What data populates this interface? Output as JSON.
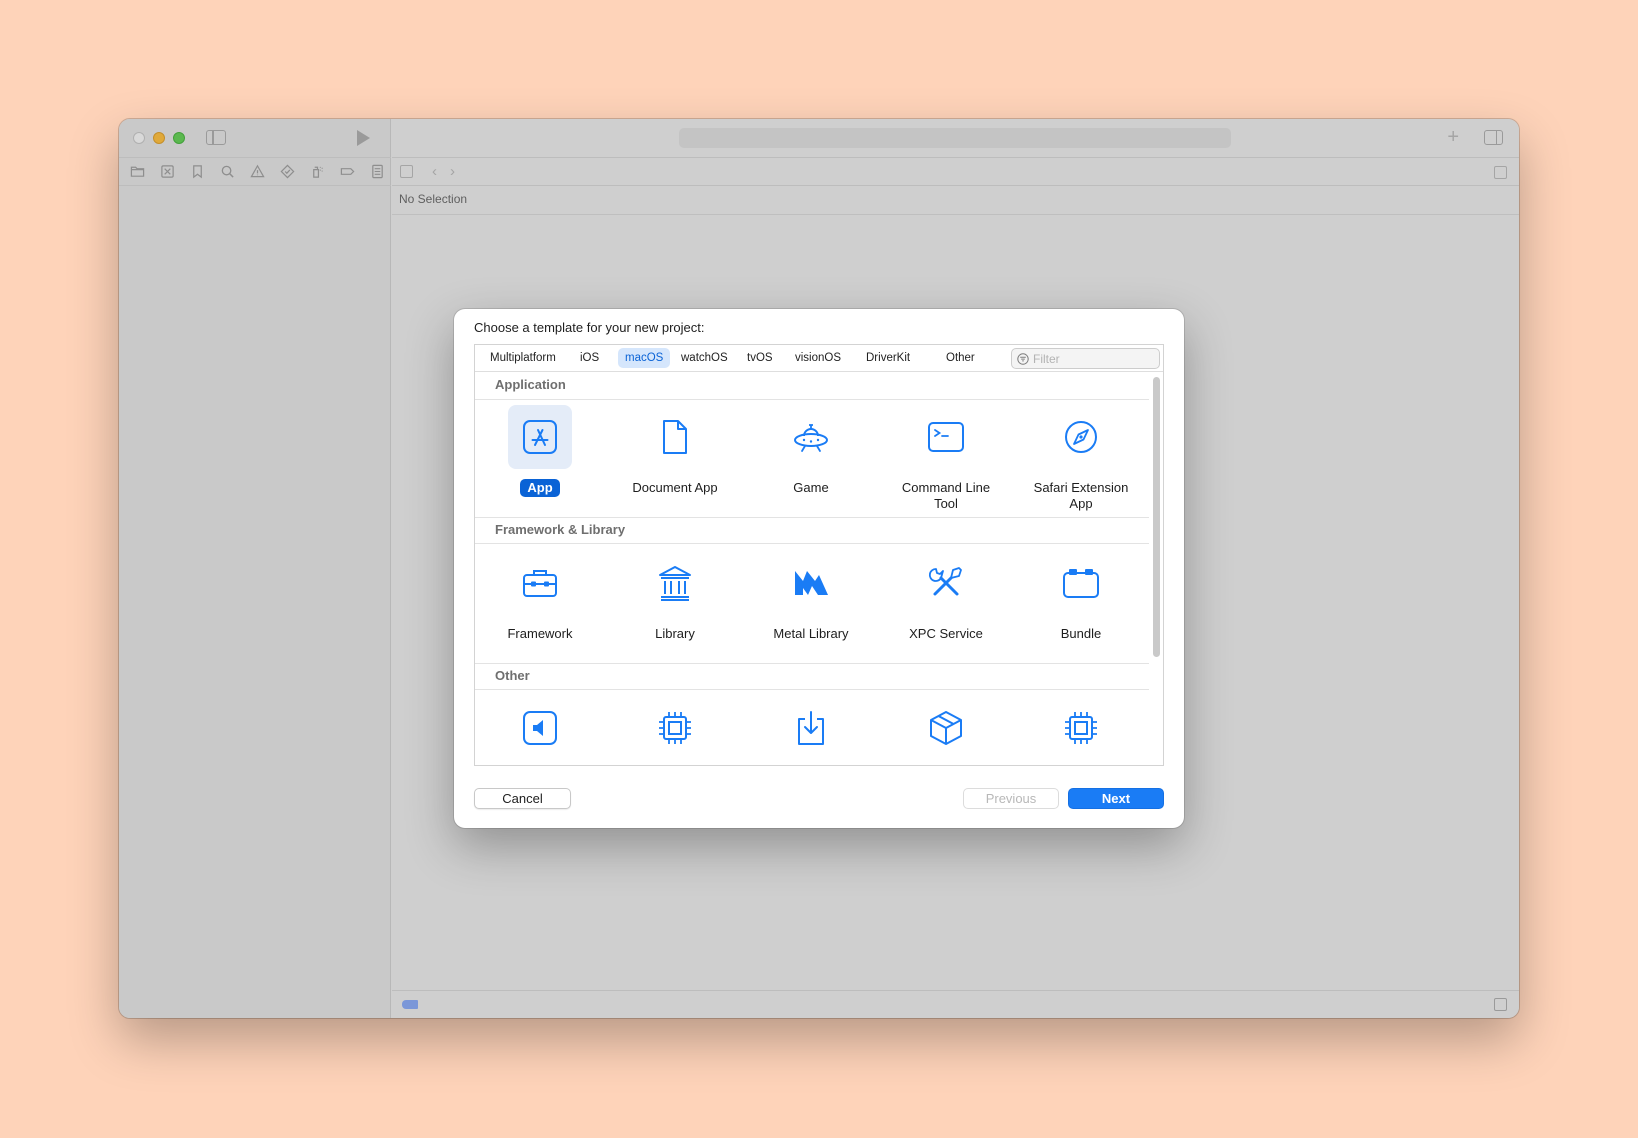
{
  "editor": {
    "no_selection": "No Selection"
  },
  "dialog": {
    "title": "Choose a template for your new project:",
    "tabs": [
      {
        "label": "Multiplatform",
        "active": false
      },
      {
        "label": "iOS",
        "active": false
      },
      {
        "label": "macOS",
        "active": true
      },
      {
        "label": "watchOS",
        "active": false
      },
      {
        "label": "tvOS",
        "active": false
      },
      {
        "label": "visionOS",
        "active": false
      },
      {
        "label": "DriverKit",
        "active": false
      },
      {
        "label": "Other",
        "active": false
      }
    ],
    "filter": {
      "placeholder": "Filter",
      "value": ""
    },
    "sections": [
      {
        "title": "Application",
        "items": [
          {
            "label": "App",
            "icon": "app-store-icon",
            "selected": true
          },
          {
            "label": "Document App",
            "icon": "document-icon",
            "selected": false
          },
          {
            "label": "Game",
            "icon": "ufo-icon",
            "selected": false
          },
          {
            "label": "Command Line Tool",
            "icon": "terminal-icon",
            "selected": false
          },
          {
            "label": "Safari Extension App",
            "icon": "compass-icon",
            "selected": false
          }
        ]
      },
      {
        "title": "Framework & Library",
        "items": [
          {
            "label": "Framework",
            "icon": "toolbox-icon",
            "selected": false
          },
          {
            "label": "Library",
            "icon": "building-columns-icon",
            "selected": false
          },
          {
            "label": "Metal Library",
            "icon": "metal-icon",
            "selected": false
          },
          {
            "label": "XPC Service",
            "icon": "wrench-screwdriver-icon",
            "selected": false
          },
          {
            "label": "Bundle",
            "icon": "bundle-icon",
            "selected": false
          }
        ]
      },
      {
        "title": "Other",
        "items": [
          {
            "label": "",
            "icon": "audio-unit-icon",
            "selected": false
          },
          {
            "label": "",
            "icon": "chip-icon",
            "selected": false
          },
          {
            "label": "",
            "icon": "installer-download-icon",
            "selected": false
          },
          {
            "label": "",
            "icon": "package-cube-icon",
            "selected": false
          },
          {
            "label": "",
            "icon": "chip-icon",
            "selected": false
          }
        ]
      }
    ],
    "buttons": {
      "cancel": "Cancel",
      "previous": "Previous",
      "next": "Next"
    }
  },
  "colors": {
    "accent": "#1a7cf5",
    "selection": "#0a63d6",
    "background": "#fed3b9"
  }
}
